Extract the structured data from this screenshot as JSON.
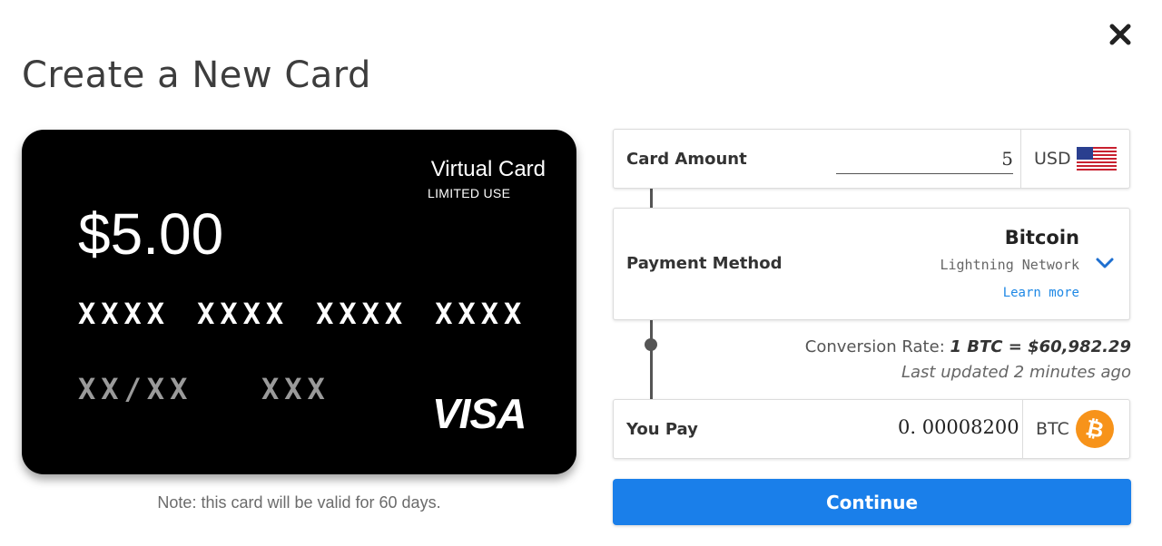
{
  "dialog": {
    "title": "Create a New Card",
    "close_icon": "close-icon"
  },
  "card": {
    "type": "Virtual Card",
    "subtitle": "LIMITED USE",
    "amount": "$5.00",
    "number_groups": [
      "XXXX",
      "XXXX",
      "XXXX",
      "XXXX"
    ],
    "expiry": "XX/XX",
    "cvv": "XXX",
    "brand": "VISA",
    "note": "Note: this card will be valid for 60 days."
  },
  "card_amount": {
    "label": "Card Amount",
    "value": "5",
    "currency": "USD",
    "currency_icon": "us-flag-icon"
  },
  "payment_method": {
    "label": "Payment Method",
    "name": "Bitcoin",
    "network": "Lightning Network",
    "learn_more": "Learn more",
    "dropdown_icon": "chevron-down-icon"
  },
  "conversion": {
    "prefix": "Conversion Rate:",
    "rate": "1 BTC = $60,982.29",
    "updated": "Last updated 2 minutes ago"
  },
  "you_pay": {
    "label": "You Pay",
    "value": "0. 00008200",
    "currency": "BTC",
    "currency_icon": "bitcoin-icon"
  },
  "continue_label": "Continue",
  "colors": {
    "accent": "#1a7fea",
    "bitcoin": "#f7931a",
    "card_bg": "#000000"
  }
}
